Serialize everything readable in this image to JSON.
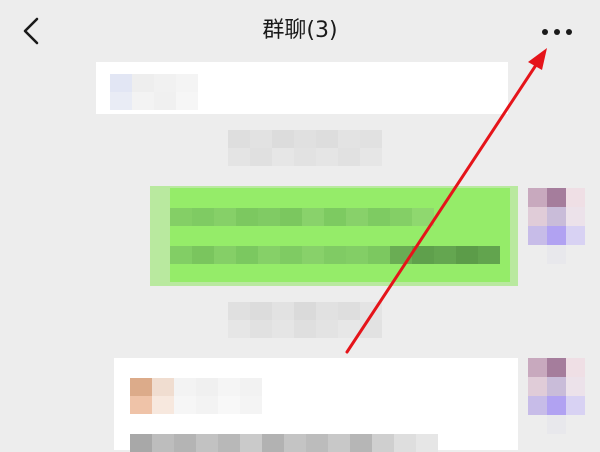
{
  "header": {
    "back_icon": "chevron-left-icon",
    "title": "群聊(3)",
    "more_icon": "ellipsis-icon"
  },
  "annotation": {
    "arrow_color": "#e5141a",
    "arrow_icon": "arrow-up-right-icon"
  },
  "colors": {
    "background": "#ededed",
    "bubble_self": "#95ec69",
    "bubble_other": "#ffffff"
  }
}
